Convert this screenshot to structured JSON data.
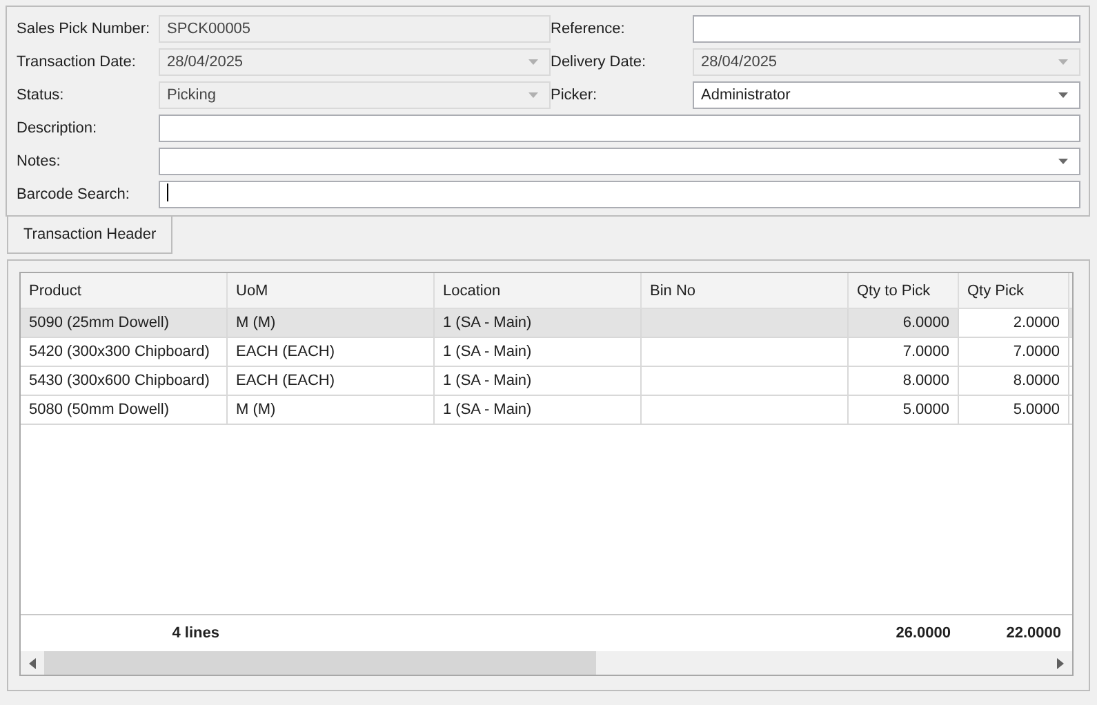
{
  "form": {
    "rows": [
      [
        {
          "label": "Sales Pick Number:",
          "value": "SPCK00005",
          "kind": "text",
          "disabled": true,
          "focused": false
        },
        {
          "label": "Reference:",
          "kind": "text",
          "disabled": false,
          "focused": false
        }
      ],
      [
        {
          "label": "Transaction Date:",
          "value": "28/04/2025",
          "kind": "dropdown",
          "disabled": true,
          "focused": false
        },
        {
          "label": "Delivery Date:",
          "value": "28/04/2025",
          "kind": "dropdown",
          "disabled": true,
          "focused": false
        }
      ],
      [
        {
          "label": "Status:",
          "value": "Picking",
          "kind": "dropdown",
          "disabled": true,
          "focused": false
        },
        {
          "label": "Picker:",
          "value": "Administrator",
          "kind": "dropdown",
          "disabled": false,
          "focused": false
        }
      ],
      [
        {
          "label": "Description:",
          "kind": "text",
          "disabled": false,
          "focused": false
        }
      ],
      [
        {
          "label": "Notes:",
          "kind": "dropdown",
          "disabled": false,
          "focused": false
        }
      ],
      [
        {
          "label": "Barcode Search:",
          "kind": "text",
          "disabled": false,
          "focused": true
        }
      ]
    ]
  },
  "tabs": [
    {
      "label": "Transaction Header",
      "selected": true
    }
  ],
  "grid": {
    "columns": [
      {
        "label": "Product",
        "kind": "text"
      },
      {
        "label": "UoM",
        "kind": "text"
      },
      {
        "label": "Location",
        "kind": "text"
      },
      {
        "label": "Bin No",
        "kind": "text"
      },
      {
        "label": "Qty to Pick",
        "kind": "number"
      },
      {
        "label": "Qty Pick",
        "kind": "entry"
      }
    ],
    "rows": [
      {
        "selected": true,
        "cells": [
          "5090 (25mm Dowell)",
          "M (M)",
          "1 (SA - Main)",
          "",
          "6.0000",
          "2.0000"
        ]
      },
      {
        "selected": false,
        "cells": [
          "5420 (300x300 Chipboard)",
          "EACH (EACH)",
          "1 (SA - Main)",
          "",
          "7.0000",
          "7.0000"
        ]
      },
      {
        "selected": false,
        "cells": [
          "5430 (300x600 Chipboard)",
          "EACH (EACH)",
          "1 (SA - Main)",
          "",
          "8.0000",
          "8.0000"
        ]
      },
      {
        "selected": false,
        "cells": [
          "5080 (50mm Dowell)",
          "M (M)",
          "1 (SA - Main)",
          "",
          "5.0000",
          "5.0000"
        ]
      }
    ],
    "summary": {
      "line_count": "4 lines",
      "qty_to_pick_total": "26.0000",
      "qty_pick_total": "22.0000"
    }
  }
}
